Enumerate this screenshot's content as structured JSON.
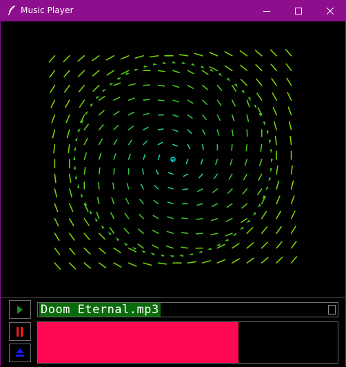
{
  "window": {
    "title": "Music Player",
    "icon": "feather-icon",
    "controls": [
      "minimize-icon",
      "maximize-icon",
      "close-icon"
    ]
  },
  "visualizer": {
    "colors": {
      "outer": "#7fd400",
      "mid": "#2fbf2f",
      "inner": "#1ad9d9"
    }
  },
  "player": {
    "play_icon": "play-icon",
    "pause_icon": "pause-icon",
    "eject_icon": "eject-icon",
    "filename": "Doom Eternal.mp3",
    "progress": 0.67,
    "colors": {
      "play": "#1f8f1f",
      "pause": "#ff1a1a",
      "eject": "#1a1aff",
      "progress": "#ff0a52",
      "filename_bg": "#0a6b0a"
    }
  }
}
